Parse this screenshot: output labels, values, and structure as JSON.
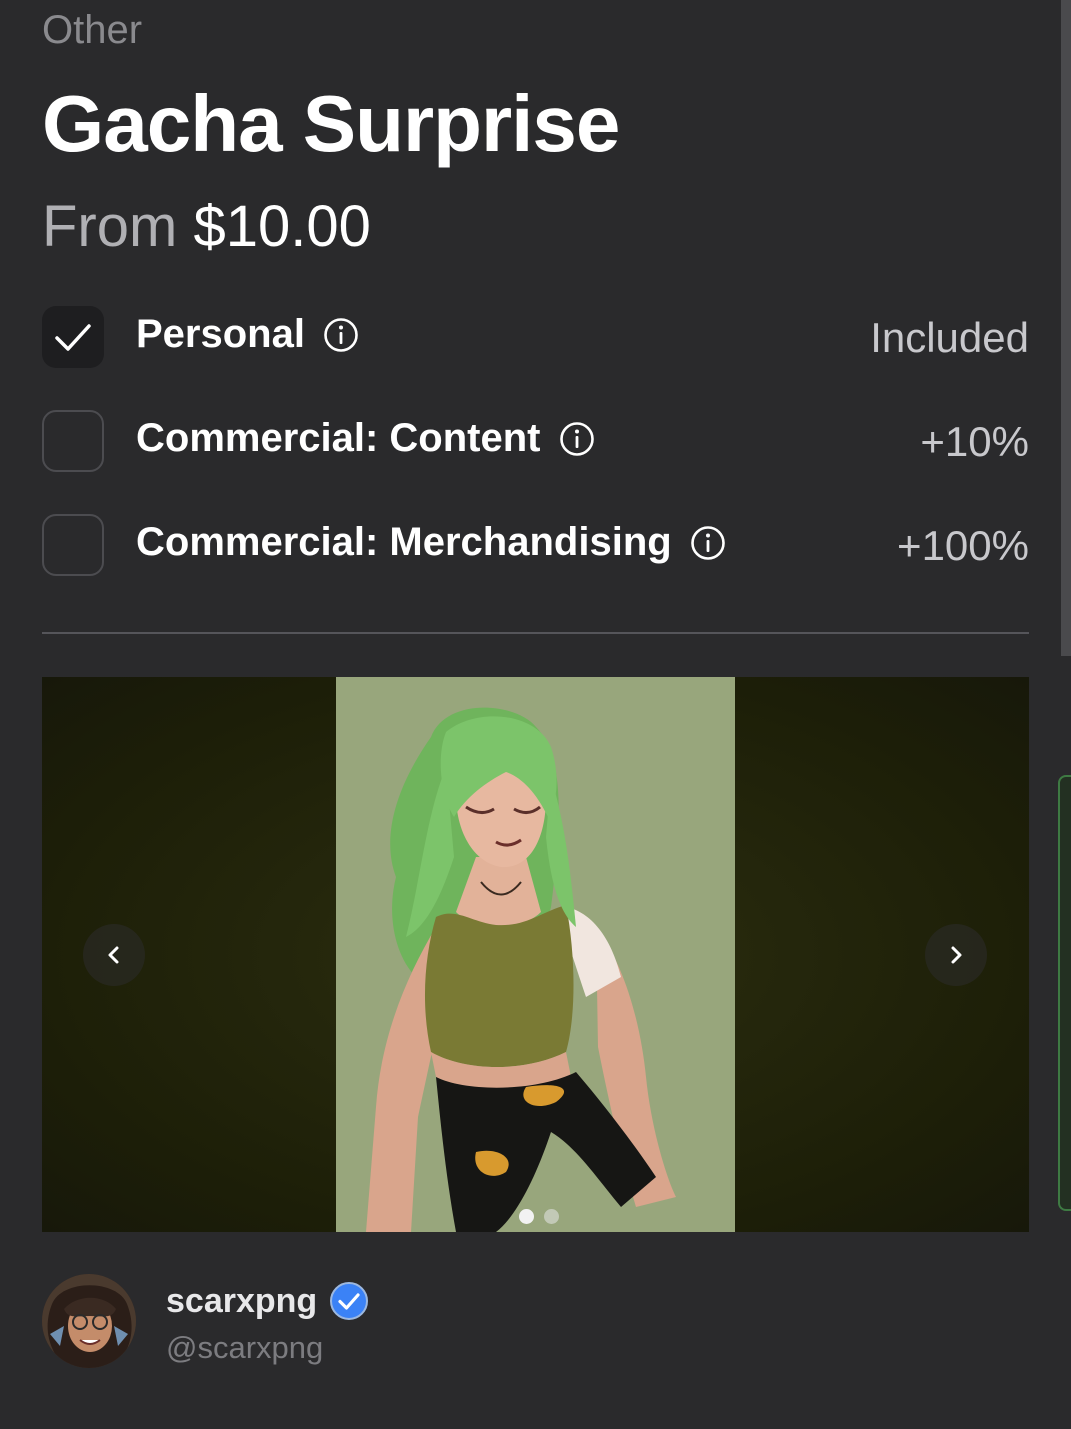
{
  "listing": {
    "category": "Other",
    "title": "Gacha Surprise",
    "price_prefix": "From",
    "price": "$10.00"
  },
  "licenses": [
    {
      "label": "Personal",
      "value": "Included",
      "checked": true
    },
    {
      "label": "Commercial: Content",
      "value": "+10%",
      "checked": false
    },
    {
      "label": "Commercial: Merchandising",
      "value": "+100%",
      "checked": false
    }
  ],
  "gallery": {
    "current_index": 1,
    "total_images": 2,
    "image_subject": "green-haired character illustration",
    "colors": {
      "artwork_bg": "#98a67c",
      "hair": "#7cc46a",
      "top": "#7a7a34"
    }
  },
  "artist": {
    "name": "scarxpng",
    "handle": "@scarxpng",
    "verified": true
  },
  "colors": {
    "background": "#2a2a2c",
    "verified_badge": "#3b82f6",
    "side_tab": "#3e7a43"
  }
}
